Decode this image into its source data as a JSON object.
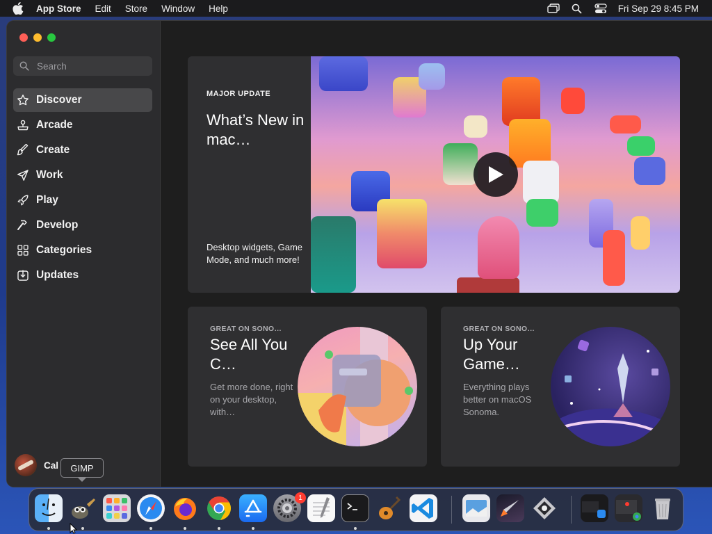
{
  "menubar": {
    "app_name": "App Store",
    "items": [
      "Edit",
      "Store",
      "Window",
      "Help"
    ],
    "clock": "Fri Sep 29  8:45 PM"
  },
  "sidebar": {
    "search_placeholder": "Search",
    "items": [
      {
        "label": "Discover",
        "icon": "star-icon",
        "active": true
      },
      {
        "label": "Arcade",
        "icon": "joystick-icon"
      },
      {
        "label": "Create",
        "icon": "brush-icon"
      },
      {
        "label": "Work",
        "icon": "paper-plane-icon"
      },
      {
        "label": "Play",
        "icon": "rocket-icon"
      },
      {
        "label": "Develop",
        "icon": "hammer-icon"
      },
      {
        "label": "Categories",
        "icon": "grid-icon"
      },
      {
        "label": "Updates",
        "icon": "download-icon"
      }
    ],
    "account_name": "Cal"
  },
  "hero": {
    "eyebrow": "MAJOR UPDATE",
    "title": "What’s New in mac…",
    "subtitle": "Desktop widgets, Game Mode, and much more!"
  },
  "cards": [
    {
      "eyebrow": "GREAT ON SONO…",
      "title": "See All You C…",
      "subtitle": "Get more done, right on your desktop, with…"
    },
    {
      "eyebrow": "GREAT ON SONO…",
      "title": "Up Your Game…",
      "subtitle": "Everything plays better on macOS Sonoma."
    }
  ],
  "dock": {
    "tooltip": "GIMP",
    "badge_count": "1",
    "apps": [
      "Finder",
      "GIMP",
      "Launchpad",
      "Safari",
      "Firefox",
      "Chrome",
      "App Store",
      "System Settings",
      "TextEdit",
      "Terminal",
      "GarageBand",
      "Visual Studio Code",
      "Preview",
      "Rocket",
      "Inkscape",
      "Window Group",
      "Chrome Window",
      "Trash"
    ]
  },
  "colors": {
    "accent_blue": "#0a84ff",
    "sidebar_bg": "#2c2c2e",
    "window_bg": "#1e1e1e",
    "card_bg": "#2f2f31"
  }
}
